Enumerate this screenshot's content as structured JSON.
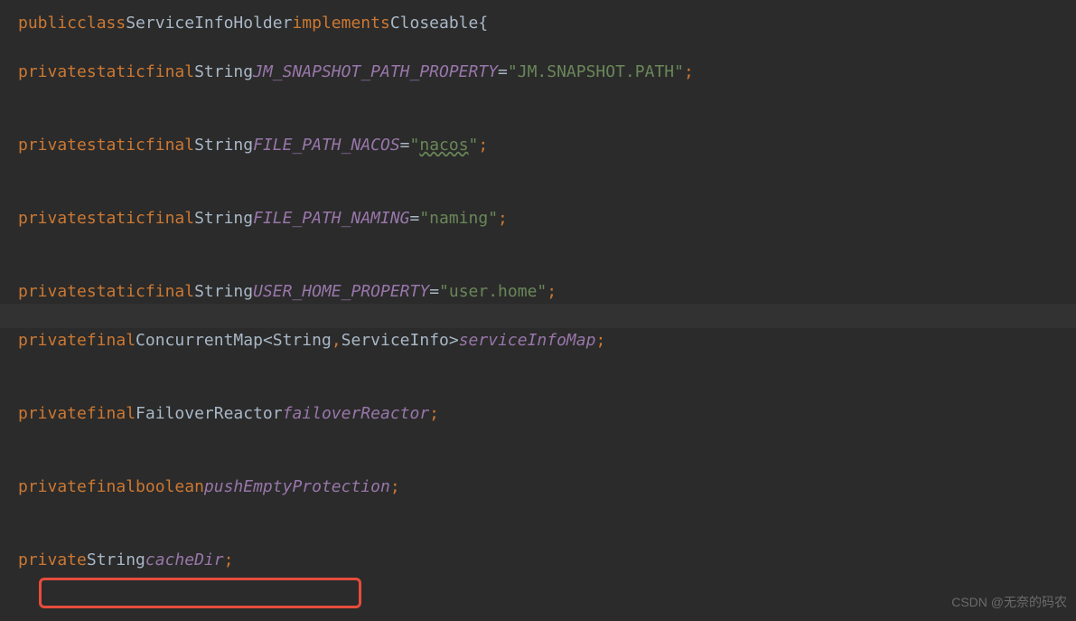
{
  "code": {
    "line1": {
      "kw_public": "public",
      "kw_class": "class",
      "class_name": "ServiceInfoHolder",
      "kw_implements": "implements",
      "interface": "Closeable",
      "brace": "{"
    },
    "line3": {
      "kw_private": "private",
      "kw_static": "static",
      "kw_final": "final",
      "type": "String",
      "field": "JM_SNAPSHOT_PATH_PROPERTY",
      "equal": "=",
      "value": "\"JM.SNAPSHOT.PATH\"",
      "semi": ";"
    },
    "line6": {
      "kw_private": "private",
      "kw_static": "static",
      "kw_final": "final",
      "type": "String",
      "field": "FILE_PATH_NACOS",
      "equal": "=",
      "quote1": "\"",
      "value": "nacos",
      "quote2": "\"",
      "semi": ";"
    },
    "line9": {
      "kw_private": "private",
      "kw_static": "static",
      "kw_final": "final",
      "type": "String",
      "field": "FILE_PATH_NAMING",
      "equal": "=",
      "value": "\"naming\"",
      "semi": ";"
    },
    "line12": {
      "kw_private": "private",
      "kw_static": "static",
      "kw_final": "final",
      "type": "String",
      "field": "USER_HOME_PROPERTY",
      "equal": "=",
      "value": "\"user.home\"",
      "semi": ";"
    },
    "line15": {
      "kw_private": "private",
      "kw_final": "final",
      "type1": "ConcurrentMap",
      "angle1": "<",
      "type2": "String",
      "comma": ",",
      "type3": "ServiceInfo",
      "angle2": ">",
      "field": "serviceInfoMap",
      "semi": ";"
    },
    "line18": {
      "kw_private": "private",
      "kw_final": "final",
      "type": "FailoverReactor",
      "field": "failoverReactor",
      "semi": ";"
    },
    "line21": {
      "kw_private": "private",
      "kw_final": "final",
      "kw_boolean": "boolean",
      "field": "pushEmptyProtection",
      "semi": ";"
    },
    "line24": {
      "kw_private": "private",
      "type": "String",
      "field": "cacheDir",
      "semi": ";"
    }
  },
  "watermark": "CSDN @无奈的码农"
}
